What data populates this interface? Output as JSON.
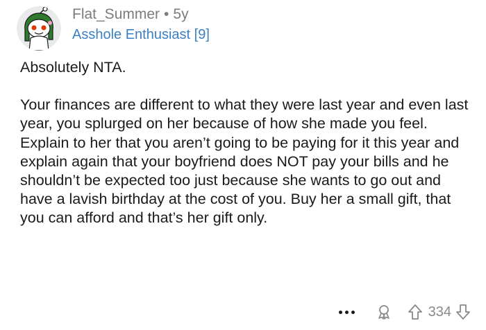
{
  "comment": {
    "author": "Flat_Summer",
    "separator": "•",
    "age": "5y",
    "flair": "Asshole Enthusiast [9]",
    "paragraphs": [
      "Absolutely NTA.",
      "Your finances are different to what they were last year and even last year, you splurged on her because of how she made you feel. Explain to her that you aren’t going to be paying for it this year and explain again that your boyfriend does NOT pay your bills and he shouldn’t be expected too just because she wants to go out and have a lavish birthday at the cost of you. Buy her a small gift, that you can afford and that’s her gift only."
    ],
    "score": "334"
  },
  "icons": {
    "avatar": "snoo-avatar",
    "more": "more-options-icon",
    "award": "award-icon",
    "upvote": "upvote-arrow-icon",
    "downvote": "downvote-arrow-icon"
  },
  "colors": {
    "flair": "#3b7fc4",
    "meta": "#7c7c7c",
    "text": "#1a1a1b",
    "action": "#878a8c"
  }
}
